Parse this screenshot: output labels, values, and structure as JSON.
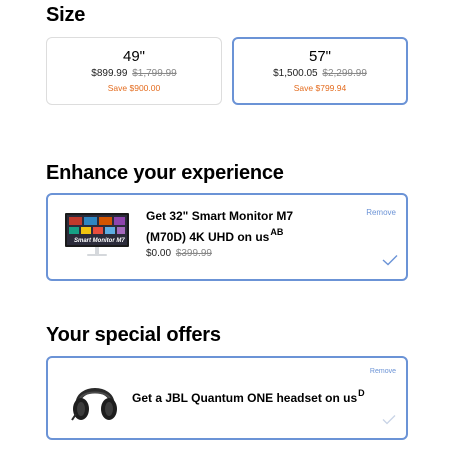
{
  "size": {
    "title": "Size",
    "options": [
      {
        "label": "49\"",
        "price": "$899.99",
        "original_price": "$1,799.99",
        "savings": "Save $900.00",
        "selected": false
      },
      {
        "label": "57\"",
        "price": "$1,500.05",
        "original_price": "$2,299.99",
        "savings": "Save $799.94",
        "selected": true
      }
    ]
  },
  "enhance": {
    "title": "Enhance your experience",
    "item": {
      "title": "Get 32\" Smart Monitor M7 (M70D) 4K UHD on us",
      "superscript": "AB",
      "price": "$0.00",
      "original_price": "$399.99",
      "remove_label": "Remove",
      "selected": true
    }
  },
  "offers": {
    "title": "Your special offers",
    "item": {
      "title": "Get a JBL Quantum ONE headset on us",
      "superscript": "D",
      "remove_label": "Remove",
      "selected": true
    }
  },
  "colors": {
    "accent": "#6b93d6",
    "savings": "#e46c1f",
    "strike": "#888888",
    "border_unselected": "#dddddd"
  }
}
